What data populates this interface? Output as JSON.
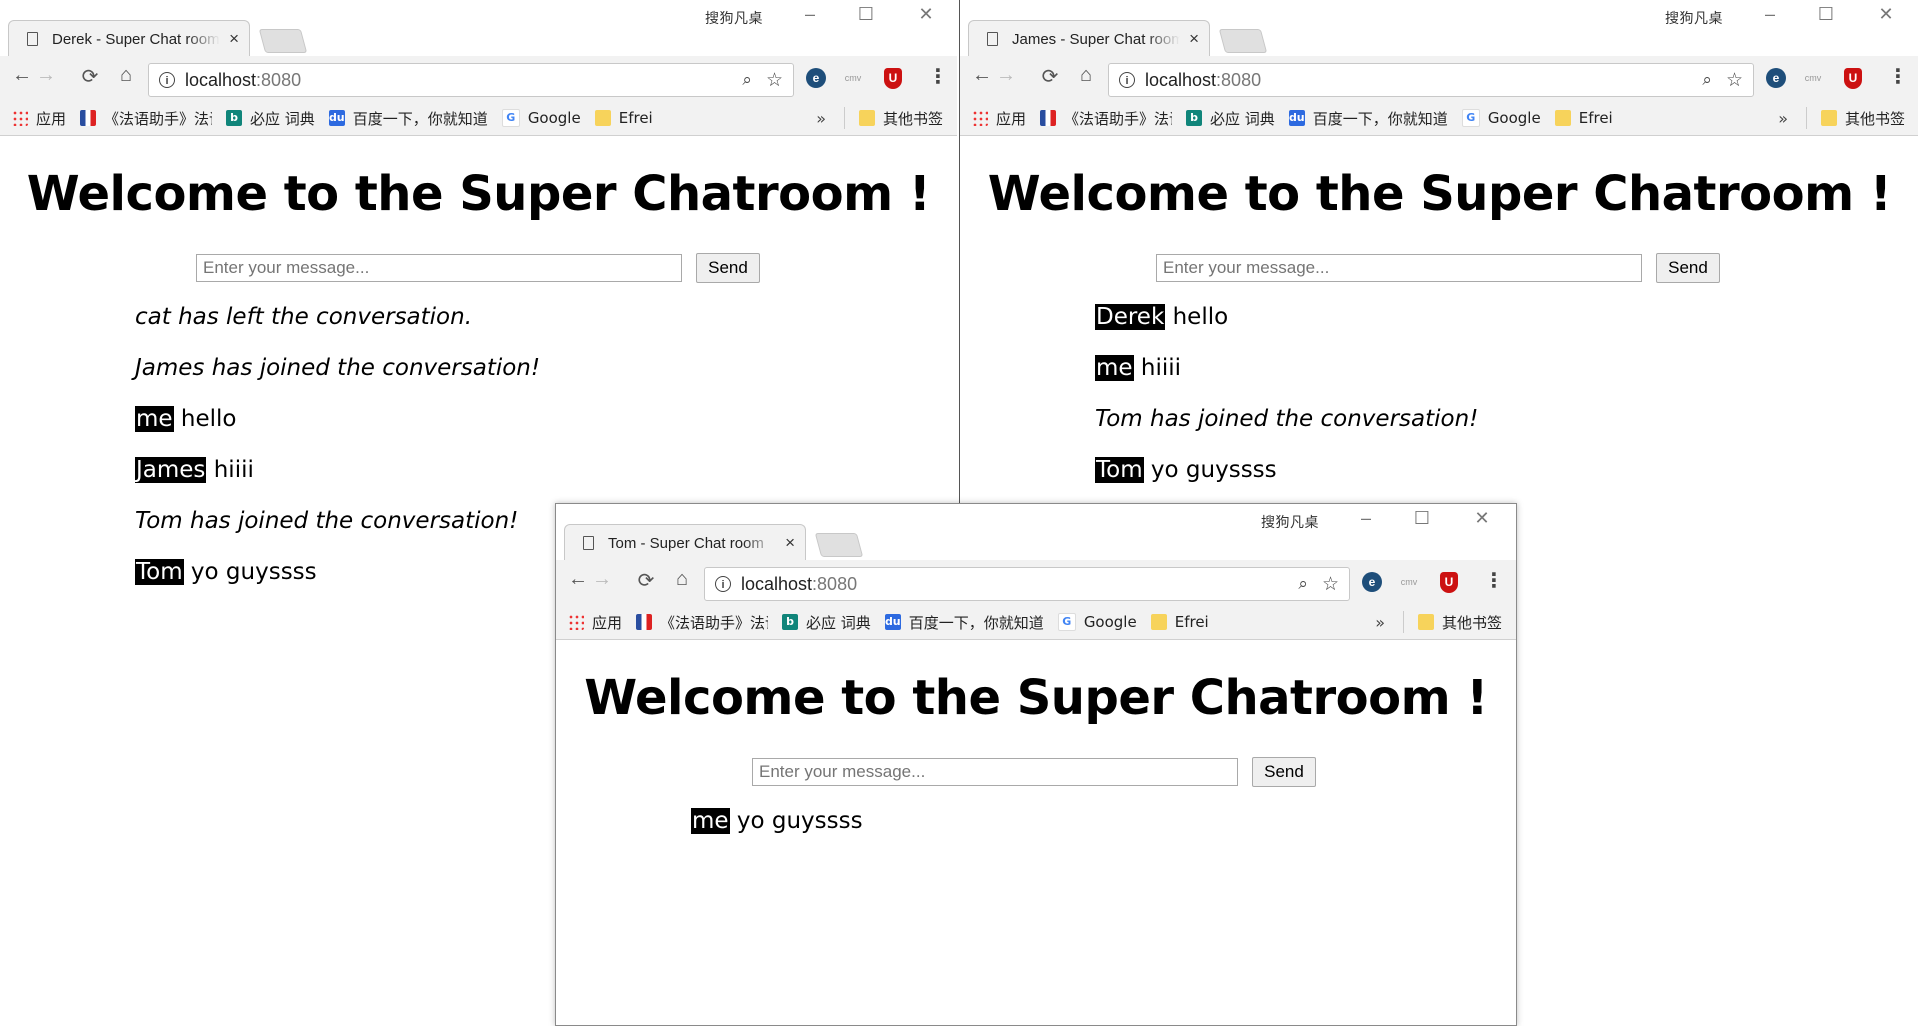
{
  "browser": {
    "tab_close": "×",
    "system_label": "搜狗凡桌",
    "url_host": "localhost",
    "url_port": ":8080",
    "bookmarks": {
      "apps": "应用",
      "french": "《法语助手》法语在线",
      "bing": "必应 词典",
      "baidu": "百度一下，你就知道",
      "google": "Google",
      "efrei": "Efrei",
      "more": "»",
      "other": "其他书签"
    }
  },
  "page": {
    "heading": "Welcome to the Super Chatroom !",
    "input_placeholder": "Enter your message...",
    "send_label": "Send"
  },
  "windows": [
    {
      "tab_title": "Derek - Super Chat room",
      "messages": [
        {
          "type": "system",
          "text": "cat has left the conversation."
        },
        {
          "type": "system",
          "text": "James has joined the conversation!"
        },
        {
          "type": "chat",
          "user": "me",
          "text": " hello"
        },
        {
          "type": "chat",
          "user": "James",
          "text": " hiiii"
        },
        {
          "type": "system",
          "text": "Tom has joined the conversation!"
        },
        {
          "type": "chat",
          "user": "Tom",
          "text": " yo guyssss"
        }
      ]
    },
    {
      "tab_title": "James - Super Chat room",
      "messages": [
        {
          "type": "chat",
          "user": "Derek",
          "text": " hello"
        },
        {
          "type": "chat",
          "user": "me",
          "text": " hiiii"
        },
        {
          "type": "system",
          "text": "Tom has joined the conversation!"
        },
        {
          "type": "chat",
          "user": "Tom",
          "text": " yo guyssss"
        }
      ]
    },
    {
      "tab_title": "Tom - Super Chat room",
      "messages": [
        {
          "type": "chat",
          "user": "me",
          "text": " yo guyssss"
        }
      ]
    }
  ]
}
